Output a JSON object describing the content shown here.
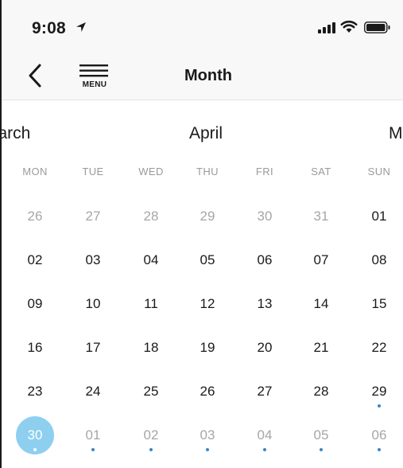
{
  "status_bar": {
    "time": "9:08",
    "location_icon": "location-arrow-icon",
    "signal_icon": "cellular-signal-icon",
    "wifi_icon": "wifi-icon",
    "battery_icon": "battery-icon"
  },
  "nav": {
    "back_icon": "chevron-left-icon",
    "menu_icon": "hamburger-icon",
    "menu_label": "MENU",
    "title": "Month"
  },
  "months": {
    "prev": "March",
    "current": "April",
    "next": "May"
  },
  "weekdays": [
    "MON",
    "TUE",
    "WED",
    "THU",
    "FRI",
    "SAT",
    "SUN"
  ],
  "weeks": [
    [
      {
        "label": "26",
        "state": "muted"
      },
      {
        "label": "27",
        "state": "muted"
      },
      {
        "label": "28",
        "state": "muted"
      },
      {
        "label": "29",
        "state": "muted"
      },
      {
        "label": "30",
        "state": "muted"
      },
      {
        "label": "31",
        "state": "muted"
      },
      {
        "label": "01",
        "state": "current"
      }
    ],
    [
      {
        "label": "02",
        "state": "current"
      },
      {
        "label": "03",
        "state": "current"
      },
      {
        "label": "04",
        "state": "current"
      },
      {
        "label": "05",
        "state": "current"
      },
      {
        "label": "06",
        "state": "current"
      },
      {
        "label": "07",
        "state": "current"
      },
      {
        "label": "08",
        "state": "current"
      }
    ],
    [
      {
        "label": "09",
        "state": "current"
      },
      {
        "label": "10",
        "state": "current"
      },
      {
        "label": "11",
        "state": "current"
      },
      {
        "label": "12",
        "state": "current"
      },
      {
        "label": "13",
        "state": "current"
      },
      {
        "label": "14",
        "state": "current"
      },
      {
        "label": "15",
        "state": "current"
      }
    ],
    [
      {
        "label": "16",
        "state": "current"
      },
      {
        "label": "17",
        "state": "current"
      },
      {
        "label": "18",
        "state": "current"
      },
      {
        "label": "19",
        "state": "current"
      },
      {
        "label": "20",
        "state": "current"
      },
      {
        "label": "21",
        "state": "current"
      },
      {
        "label": "22",
        "state": "current"
      }
    ],
    [
      {
        "label": "23",
        "state": "current"
      },
      {
        "label": "24",
        "state": "current"
      },
      {
        "label": "25",
        "state": "current"
      },
      {
        "label": "26",
        "state": "current"
      },
      {
        "label": "27",
        "state": "current"
      },
      {
        "label": "28",
        "state": "current"
      },
      {
        "label": "29",
        "state": "current",
        "event": true
      }
    ],
    [
      {
        "label": "30",
        "state": "selected",
        "event": true
      },
      {
        "label": "01",
        "state": "muted",
        "event": true
      },
      {
        "label": "02",
        "state": "muted",
        "event": true
      },
      {
        "label": "03",
        "state": "muted",
        "event": true
      },
      {
        "label": "04",
        "state": "muted",
        "event": true
      },
      {
        "label": "05",
        "state": "muted",
        "event": true
      },
      {
        "label": "06",
        "state": "muted",
        "event": true
      }
    ]
  ],
  "colors": {
    "selected_fill": "#8ecff0",
    "event_dot": "#3a86c4",
    "muted_text": "#a6a6a6",
    "header_bg": "#f8f8f8"
  }
}
